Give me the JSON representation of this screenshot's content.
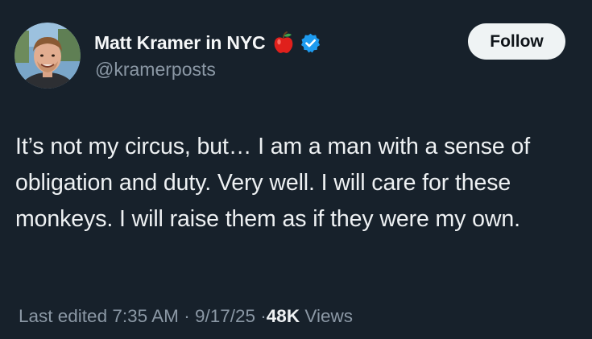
{
  "user": {
    "display_name": "Matt Kramer in NYC",
    "handle": "@kramerposts",
    "badge_icon": "apple-emoji-icon",
    "verified_icon": "verified-badge-icon",
    "verified_color": "#1d9bf0"
  },
  "follow_button": {
    "label": "Follow"
  },
  "tweet": {
    "text": "It’s not my circus, but… I am a man with a sense of obligation and duty. Very well. I will care for these monkeys. I will raise them as if they were my own."
  },
  "meta": {
    "edited_label": "Last edited",
    "time": "7:35 AM",
    "separator": "·",
    "date": "9/17/25",
    "views_count": "48K",
    "views_label": "Views"
  },
  "colors": {
    "background": "#17212b",
    "primary_text": "#e7e9ea",
    "secondary_text": "#8b98a5",
    "button_background": "#eff3f4"
  }
}
